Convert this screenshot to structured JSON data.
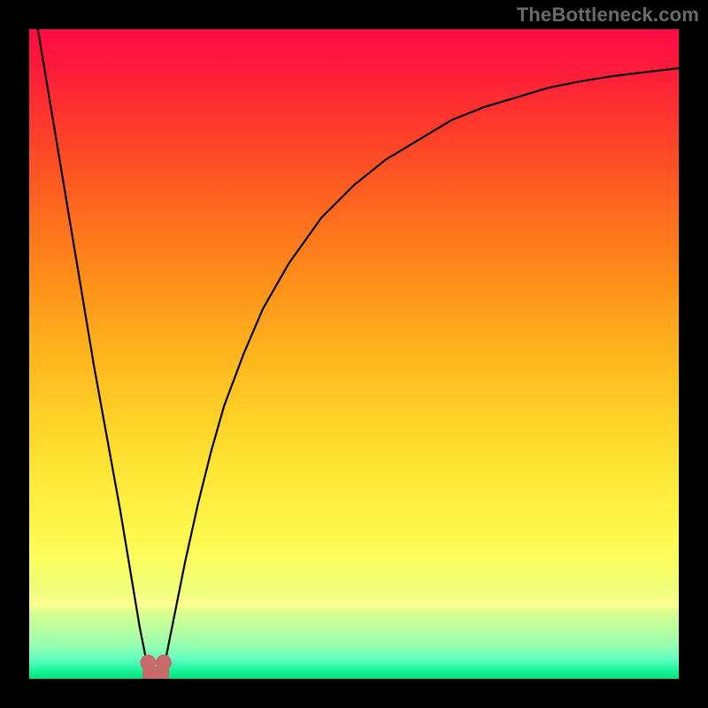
{
  "watermark": "TheBottleneck.com",
  "colors": {
    "frame": "#000000",
    "curve": "#000000",
    "marker": "#c86a6a",
    "gradient_top": "#ff0b44",
    "gradient_bottom": "#00e478"
  },
  "chart_data": {
    "type": "line",
    "title": "",
    "xlabel": "",
    "ylabel": "",
    "xlim": [
      0,
      100
    ],
    "ylim": [
      0,
      100
    ],
    "grid": false,
    "legend": false,
    "series": [
      {
        "name": "bottleneck-curve",
        "x": [
          0,
          2,
          4,
          6,
          8,
          10,
          12,
          14,
          16,
          17,
          18,
          19,
          20,
          21,
          22,
          24,
          26,
          28,
          30,
          33,
          36,
          40,
          45,
          50,
          55,
          60,
          65,
          70,
          75,
          80,
          85,
          90,
          95,
          100
        ],
        "values": [
          108,
          96,
          84,
          72,
          60,
          48,
          37,
          26,
          14,
          8,
          3,
          1,
          1,
          3,
          8,
          18,
          27,
          35,
          42,
          50,
          57,
          64,
          71,
          76,
          80,
          83,
          86,
          88,
          89.5,
          91,
          92,
          92.8,
          93.4,
          94
        ]
      }
    ],
    "markers": [
      {
        "name": "min-left",
        "x": 18.3,
        "y": 2.5
      },
      {
        "name": "min-right",
        "x": 20.7,
        "y": 2.5
      }
    ],
    "annotations": []
  }
}
